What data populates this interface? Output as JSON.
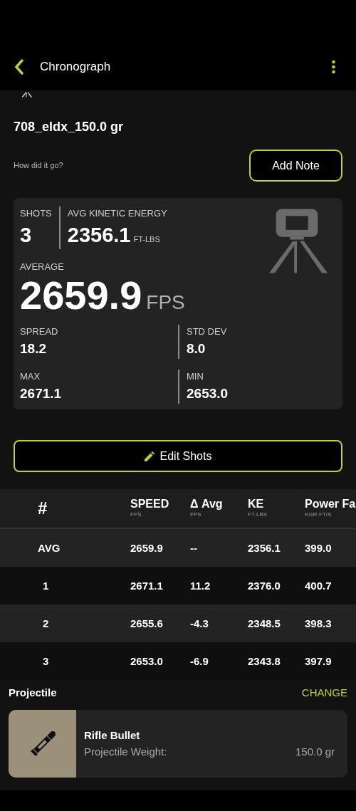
{
  "app_bar": {
    "title": "Chronograph"
  },
  "session": {
    "title": "708_eldx_150.0 gr",
    "prompt": "How did it go?",
    "note_button": "Add Note"
  },
  "summary": {
    "shots_label": "SHOTS",
    "shots": "3",
    "energy_label": "AVG KINETIC ENERGY",
    "energy": "2356.1",
    "energy_unit": "FT-LBS",
    "average_label": "AVERAGE",
    "average": "2659.9",
    "average_unit": "FPS",
    "stats": [
      {
        "label": "SPREAD",
        "value": "18.2"
      },
      {
        "label": "STD DEV",
        "value": "8.0"
      },
      {
        "label": "MAX",
        "value": "2671.1"
      },
      {
        "label": "MIN",
        "value": "2653.0"
      }
    ]
  },
  "edit_button": "Edit Shots",
  "table": {
    "columns": [
      {
        "label": "#"
      },
      {
        "label": "SPEED",
        "unit": "FPS"
      },
      {
        "label": "Δ Avg",
        "unit": "FPS"
      },
      {
        "label": "KE",
        "unit": "FT-LBS"
      },
      {
        "label": "Power Fa",
        "unit": "KGR·FT/S"
      }
    ],
    "rows": [
      [
        "AVG",
        "2659.9",
        "--",
        "2356.1",
        "399.0"
      ],
      [
        "1",
        "2671.1",
        "11.2",
        "2376.0",
        "400.7"
      ],
      [
        "2",
        "2655.6",
        "-4.3",
        "2348.5",
        "398.3"
      ],
      [
        "3",
        "2653.0",
        "-6.9",
        "2343.8",
        "397.9"
      ]
    ]
  },
  "projectile": {
    "heading": "Projectile",
    "change": "CHANGE",
    "name": "Rifle Bullet",
    "weight_label": "Projectile Weight:",
    "weight": "150.0 gr"
  }
}
